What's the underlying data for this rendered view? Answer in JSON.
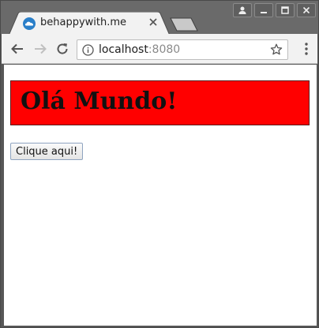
{
  "browser": {
    "tab": {
      "title": "behappywith.me",
      "favicon": "cloud-icon"
    },
    "window_controls": [
      "profile-icon",
      "minimize-icon",
      "maximize-icon",
      "close-icon"
    ],
    "address_bar": {
      "host": "localhost",
      "port": ":8080"
    }
  },
  "page": {
    "heading": "Olá Mundo!",
    "heading_background": "#ff0000",
    "button_label": "Clique aqui!"
  }
}
